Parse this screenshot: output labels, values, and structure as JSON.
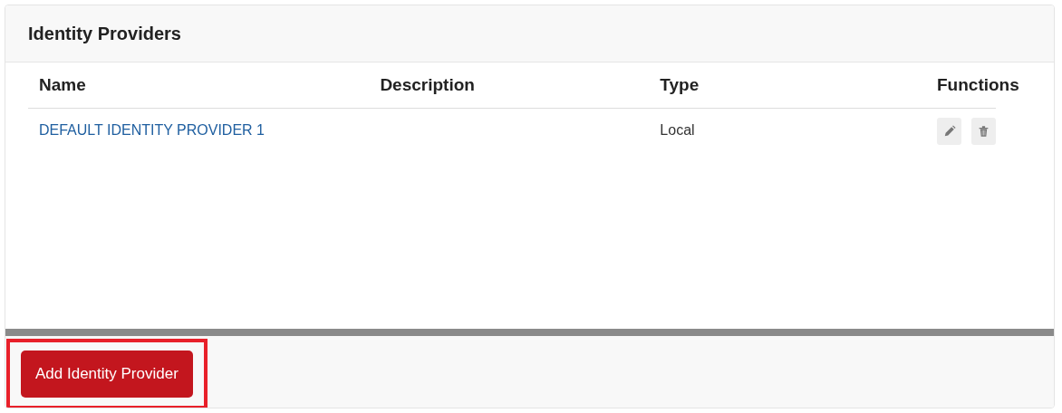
{
  "panel": {
    "title": "Identity Providers"
  },
  "table": {
    "columns": [
      "Name",
      "Description",
      "Type",
      "Functions"
    ],
    "rows": [
      {
        "name": "DEFAULT IDENTITY PROVIDER 1",
        "description": "",
        "type": "Local",
        "actions": [
          {
            "kind": "edit"
          },
          {
            "kind": "delete"
          }
        ]
      }
    ]
  },
  "footer": {
    "button": {
      "label": "Add Identity Provider",
      "highlighted": true
    }
  }
}
